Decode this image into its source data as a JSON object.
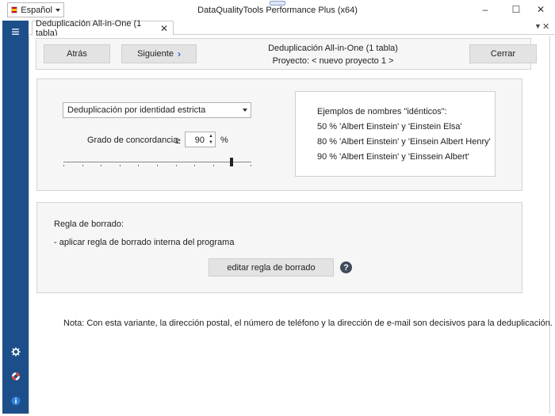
{
  "window": {
    "title": "DataQualityTools Performance Plus (x64)",
    "language": "Español",
    "controls": {
      "minimize": "–",
      "maximize": "☐",
      "close": "✕"
    }
  },
  "rail": {
    "menu_icon": "≡",
    "bottom_icons": [
      "gear-icon",
      "lifebuoy-icon",
      "info-icon"
    ]
  },
  "tab": {
    "label": "Deduplicación All-in-One (1 tabla)",
    "close": "✕",
    "menu": "▼",
    "close_all": "✕"
  },
  "nav": {
    "back_label": "Atrás",
    "next_label": "Siguiente",
    "close_label": "Cerrar",
    "title": "Deduplicación All-in-One (1 tabla)",
    "project": "Proyecto: < nuevo proyecto 1 >"
  },
  "settings": {
    "method": "Deduplicación por identidad estricta",
    "match_label": "Grado de concordancia",
    "match_operator": "≥",
    "match_value": "90",
    "match_unit": "%",
    "slider_fraction": 0.9
  },
  "examples": {
    "heading": "Ejemplos de nombres \"idénticos\":",
    "lines": [
      "50 %  'Albert Einstein' y 'Einstein Elsa'",
      "80 %  'Albert Einstein' y 'Einsein Albert Henry'",
      "90 %  'Albert Einstein' y 'Einssein Albert'"
    ]
  },
  "rule": {
    "heading": "Regla de borrado:",
    "text": "- aplicar regla de borrado interna del programa",
    "edit_button": "editar regla de borrado",
    "help": "?"
  },
  "note": "Nota: Con esta variante, la dirección postal, el número de teléfono y la dirección de e-mail son decisivos para la deduplicación.",
  "colors": {
    "rail": "#1c4f8a",
    "accent": "#1f6fd0"
  }
}
